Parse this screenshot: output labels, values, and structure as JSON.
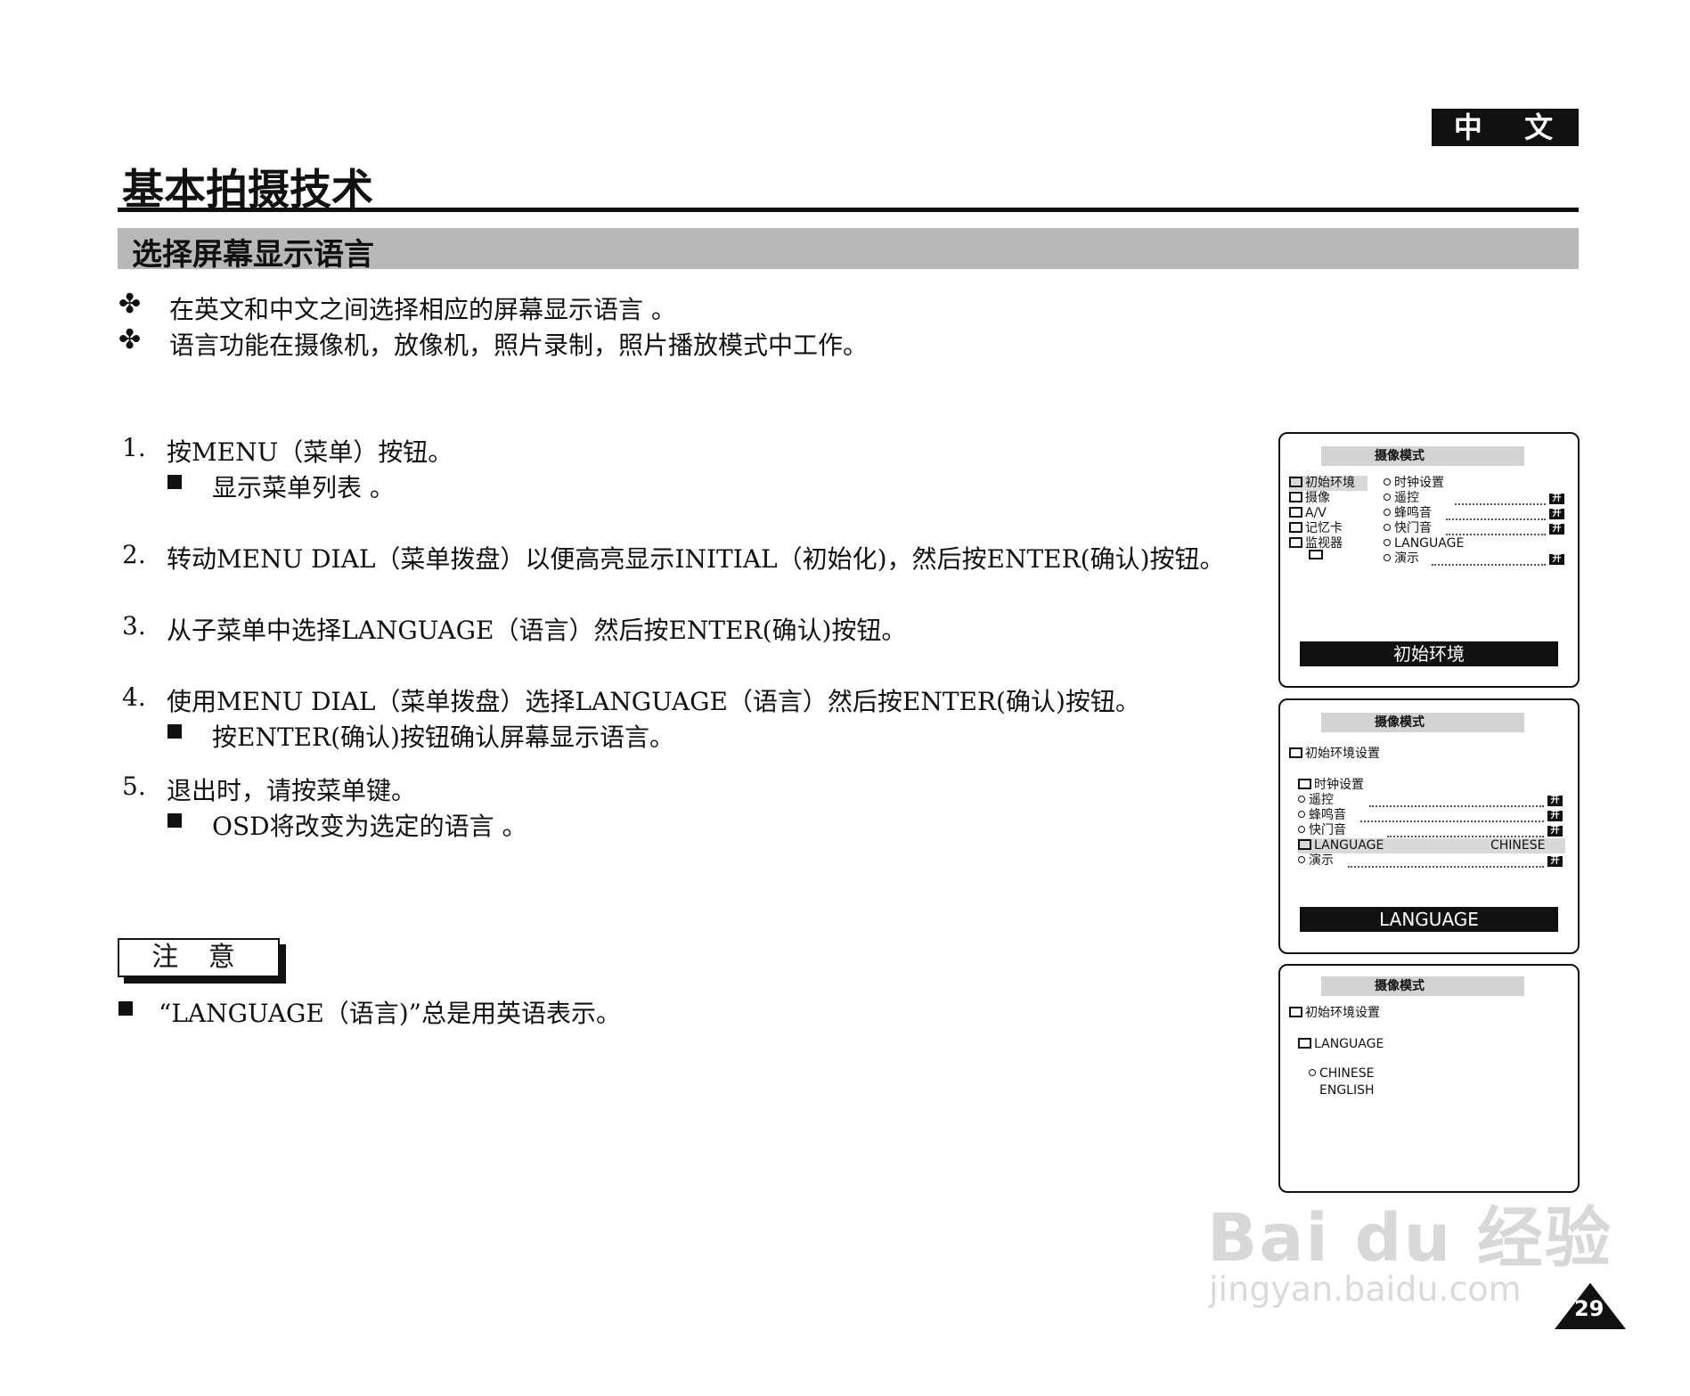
{
  "header": {
    "language_badge": "中 文",
    "page_title": "基本拍摄技术",
    "section_title": "选择屏幕显示语言"
  },
  "intro_bullets": [
    {
      "mark": "✤",
      "text": "在英文和中文之间选择相应的屏幕显示语言 。"
    },
    {
      "mark": "✤",
      "text": "语言功能在摄像机，放像机，照片录制，照片播放模式中工作。"
    }
  ],
  "steps": [
    {
      "num": "1.",
      "text": "按MENU（菜单）按钮。",
      "sub": "显示菜单列表 。"
    },
    {
      "num": "2.",
      "text": "转动MENU DIAL（菜单拨盘）以便高亮显示INITIAL（初始化)，然后按ENTER(确认)按钮。"
    },
    {
      "num": "3.",
      "text": "从子菜单中选择LANGUAGE（语言）然后按ENTER(确认)按钮。"
    },
    {
      "num": "4.",
      "text": "使用MENU DIAL（菜单拨盘）选择LANGUAGE（语言）然后按ENTER(确认)按钮。",
      "sub": "按ENTER(确认)按钮确认屏幕显示语言。"
    },
    {
      "num": "5.",
      "text": "退出时，请按菜单键。",
      "sub": "OSD将改变为选定的语言 。"
    }
  ],
  "note": {
    "label": "注 意",
    "text": "“LANGUAGE（语言)”总是用英语表示。"
  },
  "screen1": {
    "header": "摄像模式",
    "left_menu": [
      "初始环境",
      "摄像",
      "A/V",
      "记忆卡",
      "监视器"
    ],
    "right_menu": [
      "时钟设置",
      "遥控",
      "蜂鸣音",
      "快门音",
      "LANGUAGE",
      "演示"
    ],
    "on_label": "开",
    "footer": "初始环境"
  },
  "screen2": {
    "header": "摄像模式",
    "path": "初始环境设置",
    "items": [
      "时钟设置",
      "遥控",
      "蜂鸣音",
      "快门音",
      "LANGUAGE",
      "演示"
    ],
    "language_value": "CHINESE",
    "on_label": "开",
    "footer": "LANGUAGE"
  },
  "screen3": {
    "header": "摄像模式",
    "path": "初始环境设置",
    "sub": "LANGUAGE",
    "options": [
      "CHINESE",
      "ENGLISH"
    ]
  },
  "page_number": "29",
  "watermark": {
    "logo": "Bai du 经验",
    "url": "jingyan.baidu.com"
  }
}
